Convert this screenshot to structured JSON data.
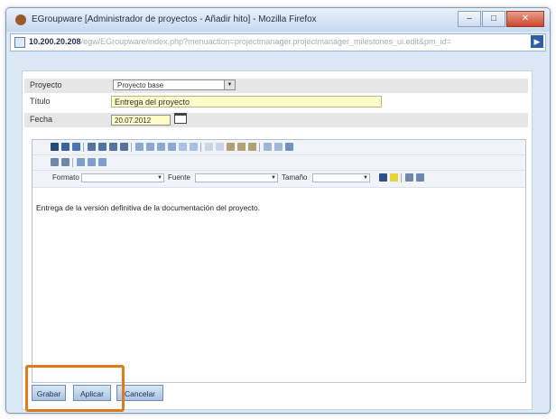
{
  "window": {
    "title": "EGroupware [Administrador de proyectos - Añadir hito] - Mozilla Firefox",
    "controls": [
      "–",
      "□",
      "✕"
    ]
  },
  "address": {
    "host": "10.200.20.208",
    "path": "/egw/EGroupware/index.php?menuaction=projectmanager.projectmanager_milestones_ui.edit&pm_id="
  },
  "form": {
    "proyecto_label": "Proyecto",
    "proyecto_value": "Proyecto base",
    "titulo_label": "Título",
    "titulo_value": "Entrega del proyecto",
    "fecha_label": "Fecha",
    "fecha_value": "20.07.2012"
  },
  "editor": {
    "formato_label": "Formato",
    "fuente_label": "Fuente",
    "tamano_label": "Tamaño",
    "body_text": "Entrega de la versión definitiva de la documentación del proyecto."
  },
  "buttons": {
    "grabar": "Grabar",
    "aplicar": "Aplicar",
    "cancelar": "Cancelar"
  },
  "colors": {
    "highlight": "#e07a18",
    "field_bg": "#fffbc8",
    "window_blue": "#dbe8f6"
  }
}
